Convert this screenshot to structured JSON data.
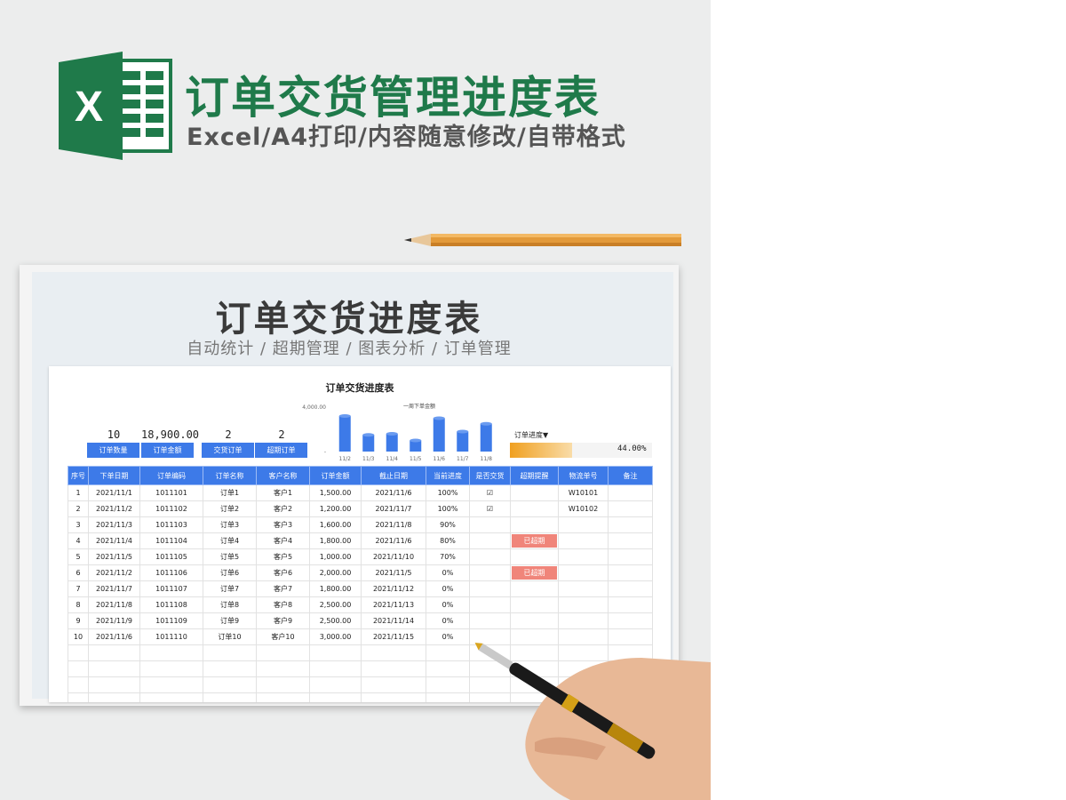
{
  "banner": {
    "logo_letter": "X",
    "title": "订单交货管理进度表",
    "subtitle": "Excel/A4打印/内容随意修改/自带格式"
  },
  "paper": {
    "title": "订单交货进度表",
    "subtitle": "自动统计 / 超期管理 / 图表分析 / 订单管理"
  },
  "sheet": {
    "title": "订单交货进度表",
    "kpis": [
      {
        "value": "10",
        "label": "订单数量"
      },
      {
        "value": "18,900.00",
        "label": "订单金额"
      },
      {
        "value": "2",
        "label": "交货订单"
      },
      {
        "value": "2",
        "label": "超期订单"
      }
    ],
    "progress": {
      "label": "订单进度▼",
      "value_text": "44.00%",
      "fraction": 0.44
    },
    "columns": [
      "序号",
      "下单日期",
      "订单编码",
      "订单名称",
      "客户名称",
      "订单金额",
      "截止日期",
      "当前进度",
      "是否交货",
      "超期提醒",
      "物流单号",
      "备注"
    ],
    "rows": [
      [
        "1",
        "2021/11/1",
        "1011101",
        "订单1",
        "客户1",
        "1,500.00",
        "2021/11/6",
        "100%",
        "☑",
        "",
        "W10101",
        ""
      ],
      [
        "2",
        "2021/11/2",
        "1011102",
        "订单2",
        "客户2",
        "1,200.00",
        "2021/11/7",
        "100%",
        "☑",
        "",
        "W10102",
        ""
      ],
      [
        "3",
        "2021/11/3",
        "1011103",
        "订单3",
        "客户3",
        "1,600.00",
        "2021/11/8",
        "90%",
        "",
        "",
        "",
        ""
      ],
      [
        "4",
        "2021/11/4",
        "1011104",
        "订单4",
        "客户4",
        "1,800.00",
        "2021/11/6",
        "80%",
        "",
        "已超期",
        "",
        ""
      ],
      [
        "5",
        "2021/11/5",
        "1011105",
        "订单5",
        "客户5",
        "1,000.00",
        "2021/11/10",
        "70%",
        "",
        "",
        "",
        ""
      ],
      [
        "6",
        "2021/11/2",
        "1011106",
        "订单6",
        "客户6",
        "2,000.00",
        "2021/11/5",
        "0%",
        "",
        "已超期",
        "",
        ""
      ],
      [
        "7",
        "2021/11/7",
        "1011107",
        "订单7",
        "客户7",
        "1,800.00",
        "2021/11/12",
        "0%",
        "",
        "",
        "",
        ""
      ],
      [
        "8",
        "2021/11/8",
        "1011108",
        "订单8",
        "客户8",
        "2,500.00",
        "2021/11/13",
        "0%",
        "",
        "",
        "",
        ""
      ],
      [
        "9",
        "2021/11/9",
        "1011109",
        "订单9",
        "客户9",
        "2,500.00",
        "2021/11/14",
        "0%",
        "",
        "",
        "",
        ""
      ],
      [
        "10",
        "2021/11/6",
        "1011110",
        "订单10",
        "客户10",
        "3,000.00",
        "2021/11/15",
        "0%",
        "",
        "",
        "",
        ""
      ]
    ]
  },
  "colors": {
    "accent": "#3d7ae8",
    "brand_green": "#1f7a4a",
    "overdue": "#f0857a",
    "progress": "#f0a020"
  },
  "chart_data": {
    "type": "bar",
    "title": "一周下单金额",
    "categories": [
      "11/2",
      "11/3",
      "11/4",
      "11/5",
      "11/6",
      "11/7",
      "11/8"
    ],
    "values": [
      3200,
      1500,
      1600,
      1000,
      3000,
      1800,
      2500
    ],
    "ylim": [
      0,
      4000
    ],
    "yticks": [
      "4,000.00",
      "-"
    ],
    "grid": false,
    "legend": "none"
  }
}
